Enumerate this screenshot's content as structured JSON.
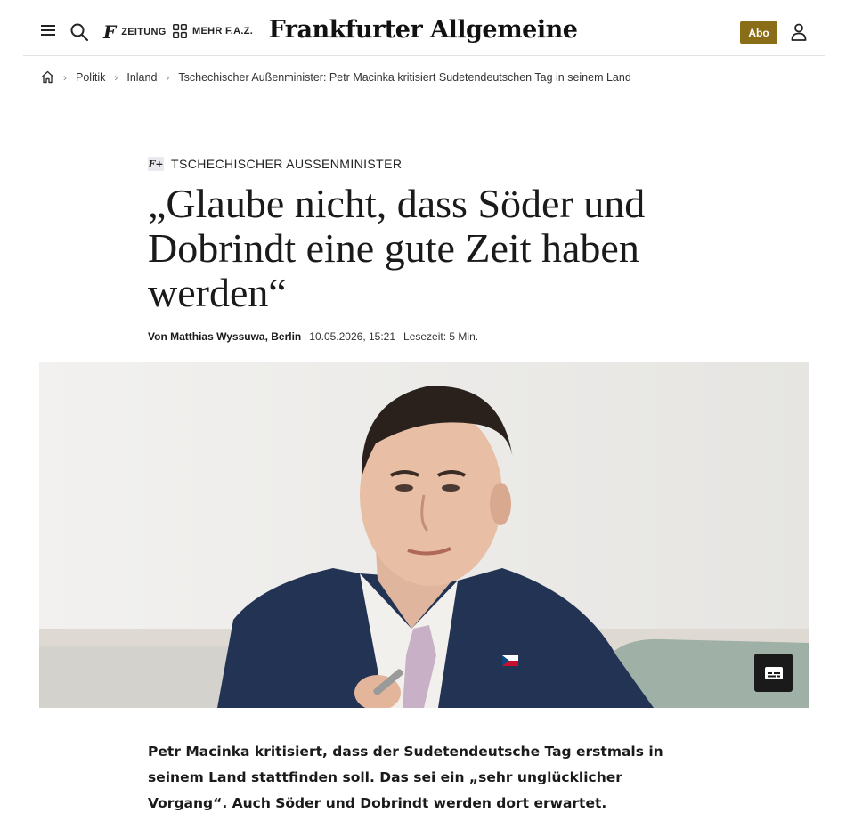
{
  "header": {
    "brand": "Frankfurter Allgemeine",
    "zeitung_logo": "F",
    "zeitung_label": "ZEITUNG",
    "mehr_label": "MEHR F.A.Z.",
    "abo_label": "Abo",
    "icons": [
      "menu-icon",
      "search-icon",
      "grid-icon",
      "user-icon",
      "home-icon",
      "chevron-right-icon",
      "subtitles-icon"
    ],
    "accent_color": "#8a6d17"
  },
  "breadcrumb": {
    "items": [
      "Politik",
      "Inland"
    ],
    "current": "Tschechischer Außenminister: Petr Macinka kritisiert Sudetendeutschen Tag in seinem Land"
  },
  "article": {
    "plus_badge": "F+",
    "kicker": "TSCHECHISCHER AUSSENMINISTER",
    "headline": "„Glaube nicht, dass Söder und Dobrindt eine gute Zeit haben werden“",
    "author": "Von Matthias Wyssuwa, Berlin",
    "date": "10.05.2026, 15:21",
    "reading_time": "Lesezeit: 5 Min.",
    "teaser": "Petr Macinka kritisiert, dass der Sudetendeutsche Tag erstmals in seinem Land stattfinden soll. Das sei ein „sehr unglücklicher Vorgang“. Auch Söder und Dobrindt werden dort erwartet."
  }
}
